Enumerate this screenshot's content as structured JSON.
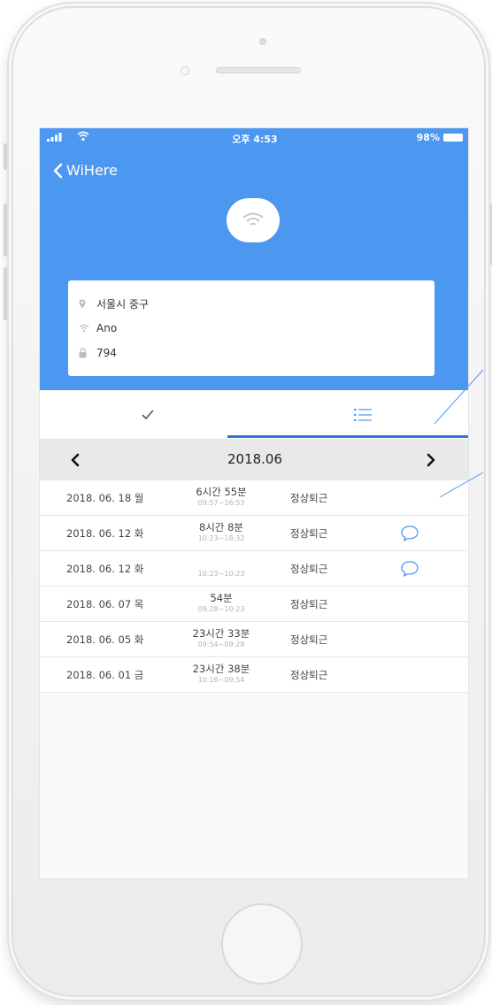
{
  "status_bar": {
    "time": "오후 4:53",
    "battery": "98%"
  },
  "nav": {
    "back_label": "WiHere"
  },
  "info": {
    "address": "서울시 중구",
    "wifi": "Ano",
    "code": "794"
  },
  "tabs": [
    {
      "icon": "check-icon"
    },
    {
      "icon": "list-icon",
      "active": true
    }
  ],
  "month": {
    "label": "2018.06"
  },
  "records": [
    {
      "date": "2018. 06. 18 월",
      "duration": "6시간 55분",
      "range": "09:57~16:53",
      "status": "정상퇴근",
      "comment": false
    },
    {
      "date": "2018. 06. 12 화",
      "duration": "8시간 8분",
      "range": "10:23~18:32",
      "status": "정상퇴근",
      "comment": true
    },
    {
      "date": "2018. 06. 12 화",
      "duration": "",
      "range": "10:23~10:23",
      "status": "정상퇴근",
      "comment": true
    },
    {
      "date": "2018. 06. 07 목",
      "duration": "54분",
      "range": "09:28~10:23",
      "status": "정상퇴근",
      "comment": false
    },
    {
      "date": "2018. 06. 05 화",
      "duration": "23시간 33분",
      "range": "09:54~09:28",
      "status": "정상퇴근",
      "comment": false
    },
    {
      "date": "2018. 06. 01 금",
      "duration": "23시간 38분",
      "range": "10:16~09:54",
      "status": "정상퇴근",
      "comment": false
    }
  ],
  "colors": {
    "header_blue": "#4c97f0",
    "accent_blue": "#2f74d4",
    "comment_icon": "#4c97f0"
  }
}
